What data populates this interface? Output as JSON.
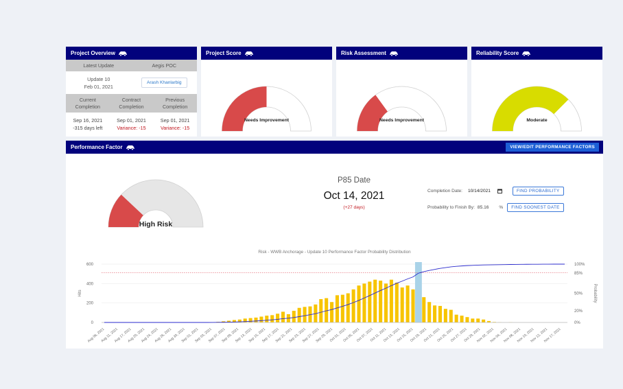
{
  "colors": {
    "header": "#02027c",
    "red": "#d84a4a",
    "yellow": "#d8dc00",
    "bar": "#f7c400",
    "highlight": "#a9d3e8",
    "line": "#2a2acc",
    "p85": "#d34"
  },
  "overview": {
    "title": "Project Overview",
    "latest_update_label": "Latest Update",
    "aegis_poc_label": "Aegis POC",
    "update_name": "Update 10",
    "update_date": "Feb 01, 2021",
    "poc_name": "Arash Khanlarbig",
    "current_completion_label": [
      "Current",
      "Completion"
    ],
    "contract_completion_label": [
      "Contract",
      "Completion"
    ],
    "previous_completion_label": [
      "Previous",
      "Completion"
    ],
    "current_date": "Sep 16, 2021",
    "current_days_left": "-315 days left",
    "contract_date": "Sep 01, 2021",
    "contract_variance": "Variance: -15",
    "previous_date": "Sep 01, 2021",
    "previous_variance": "Variance: -15"
  },
  "project_score": {
    "title": "Project Score",
    "label": "Needs Improvement",
    "level": 0.5
  },
  "risk_assessment": {
    "title": "Risk Assessment",
    "label": "Needs Improvement",
    "level": 0.3
  },
  "reliability_score": {
    "title": "Reliability Score",
    "label": "Moderate",
    "level": 0.75
  },
  "performance": {
    "title": "Performance Factor",
    "edit_button": "VIEW/EDIT PERFORMANCE FACTORS",
    "gauge_label": "High Risk",
    "gauge_level": 0.24,
    "p85_title": "P85 Date",
    "p85_date": "Oct 14, 2021",
    "p85_delta": "(+27 days)",
    "completion_date_label": "Completion Date:",
    "completion_date_value": "10/14/2021",
    "find_probability": "FIND PROBABILITY",
    "probability_label": "Probability to Finish By:",
    "probability_value": "85.16",
    "probability_unit": "%",
    "find_soonest": "FIND SOONEST DATE"
  },
  "chart_data": {
    "type": "bar",
    "title": "Risk - WWB Anchorage - Update 10 Performance Factor Probability Distribution",
    "ylabel": "Hits",
    "y2label": "Probability",
    "ylim": [
      0,
      600
    ],
    "yticks": [
      0,
      200,
      400,
      600
    ],
    "y2ticks": [
      "0%",
      "20%",
      "50%",
      "85%",
      "100%"
    ],
    "y2tick_values": [
      0,
      0.2,
      0.5,
      0.85,
      1.0
    ],
    "p85_line": 0.85,
    "highlight_label": "Oct 14, 2021",
    "xtick_labels": [
      "Aug 06, 2021",
      "Aug 11, 2021",
      "Aug 17, 2021",
      "Aug 20, 2021",
      "Aug 24, 2021",
      "Aug 26, 2021",
      "Aug 30, 2021",
      "Sep 01, 2021",
      "Sep 03, 2021",
      "Sep 07, 2021",
      "Sep 09, 2021",
      "Sep 13, 2021",
      "Sep 15, 2021",
      "Sep 17, 2021",
      "Sep 21, 2021",
      "Sep 23, 2021",
      "Sep 27, 2021",
      "Sep 29, 2021",
      "Oct 01, 2021",
      "Oct 05, 2021",
      "Oct 07, 2021",
      "Oct 11, 2021",
      "Oct 13, 2021",
      "Oct 15, 2021",
      "Oct 19, 2021",
      "Oct 21, 2021",
      "Oct 25, 2021",
      "Oct 27, 2021",
      "Oct 29, 2021",
      "Nov 02, 2021",
      "Nov 04, 2021",
      "Nov 08, 2021",
      "Nov 10, 2021",
      "Nov 12, 2021",
      "Nov 17, 2021"
    ],
    "values": [
      0,
      0,
      0,
      0,
      0,
      0,
      0,
      0,
      0,
      0,
      1,
      2,
      0,
      2,
      0,
      0,
      0,
      0,
      0,
      2,
      3,
      6,
      12,
      18,
      25,
      30,
      40,
      45,
      50,
      60,
      70,
      75,
      90,
      110,
      85,
      120,
      150,
      160,
      165,
      185,
      240,
      250,
      210,
      280,
      285,
      300,
      340,
      380,
      400,
      420,
      440,
      430,
      400,
      440,
      410,
      360,
      380,
      340,
      600,
      260,
      210,
      175,
      170,
      140,
      130,
      80,
      70,
      55,
      40,
      40,
      30,
      15,
      5,
      2,
      0,
      2,
      0,
      0,
      0,
      0,
      0,
      0,
      0,
      0,
      0,
      0
    ],
    "highlight_index": 58,
    "cdf": [
      0,
      0,
      0,
      0,
      0,
      0,
      0,
      0,
      0,
      0,
      0,
      0,
      0,
      0,
      0,
      0,
      0,
      0,
      0,
      0,
      0.001,
      0.002,
      0.003,
      0.005,
      0.008,
      0.011,
      0.015,
      0.02,
      0.025,
      0.031,
      0.038,
      0.045,
      0.054,
      0.065,
      0.073,
      0.085,
      0.1,
      0.116,
      0.133,
      0.151,
      0.175,
      0.2,
      0.221,
      0.249,
      0.277,
      0.307,
      0.341,
      0.379,
      0.419,
      0.461,
      0.505,
      0.548,
      0.588,
      0.632,
      0.673,
      0.709,
      0.747,
      0.781,
      0.845,
      0.871,
      0.892,
      0.91,
      0.927,
      0.941,
      0.954,
      0.962,
      0.969,
      0.975,
      0.979,
      0.983,
      0.986,
      0.988,
      0.989,
      0.99,
      0.992,
      0.994,
      0.995,
      0.996,
      0.997,
      0.998,
      0.998,
      0.999,
      0.999,
      1.0,
      1.0,
      1.0
    ]
  }
}
